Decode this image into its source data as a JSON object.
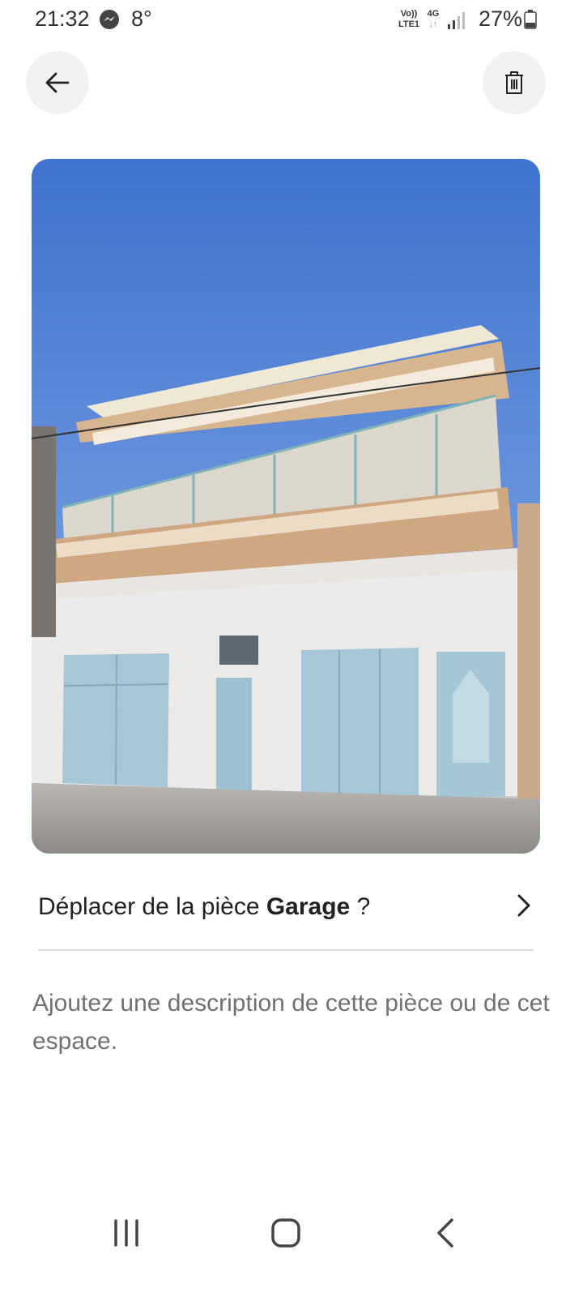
{
  "status_bar": {
    "time": "21:32",
    "temperature": "8°",
    "volte_top": "Vo))",
    "volte_bottom": "LTE1",
    "network": "4G",
    "network_arrows": "↓↑",
    "battery_percent": "27%",
    "icons": [
      "messenger-icon",
      "signal-icon",
      "battery-icon"
    ]
  },
  "toolbar": {
    "back_icon": "arrow-left-icon",
    "delete_icon": "trash-icon",
    "button_bg": "#f2f2f2"
  },
  "move_row": {
    "prefix": "Déplacer de la pièce ",
    "room": "Garage",
    "suffix": " ?",
    "chevron_icon": "chevron-right-icon"
  },
  "description_placeholder": "Ajoutez une description de cette pièce ou de cet espace.",
  "nav_bar": {
    "icons": [
      "recent-apps-icon",
      "home-icon",
      "back-icon"
    ]
  },
  "colors": {
    "text_primary": "#222222",
    "text_secondary": "#717171",
    "divider": "#dddddd",
    "sky": "#4f83d6"
  }
}
